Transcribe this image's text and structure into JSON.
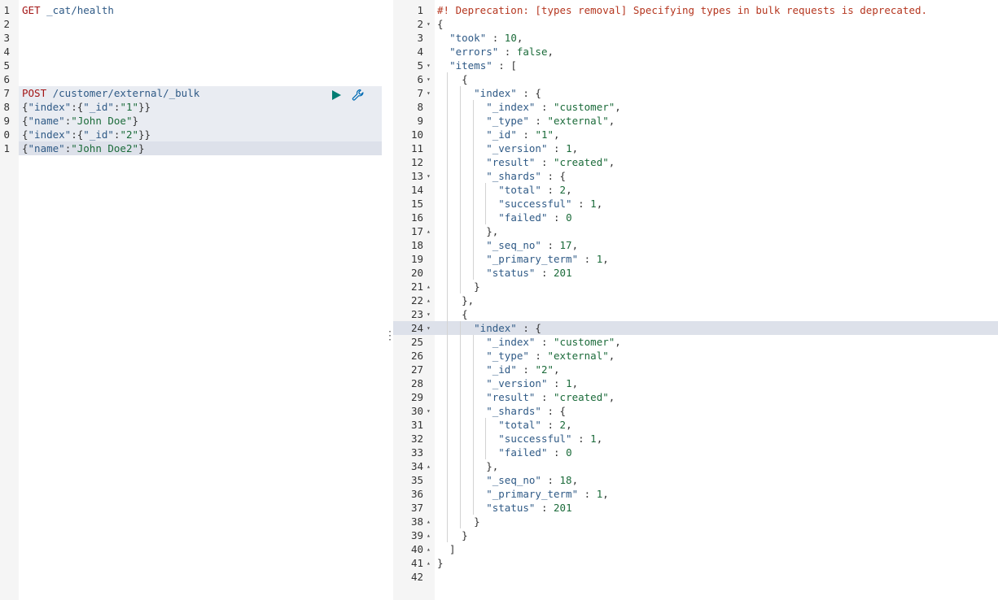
{
  "request_editor": {
    "lines": [
      {
        "num": "1",
        "segments": [
          {
            "t": "GET",
            "c": "method"
          },
          {
            "t": " _cat/health",
            "c": "path"
          }
        ]
      },
      {
        "num": "2",
        "segments": []
      },
      {
        "num": "3",
        "segments": []
      },
      {
        "num": "4",
        "segments": []
      },
      {
        "num": "5",
        "segments": []
      },
      {
        "num": "6",
        "segments": []
      },
      {
        "num": "7",
        "segments": [
          {
            "t": "POST",
            "c": "method"
          },
          {
            "t": " /customer/external/_bulk",
            "c": "path"
          }
        ]
      },
      {
        "num": "8",
        "segments": [
          {
            "t": "{",
            "c": "punc"
          },
          {
            "t": "\"index\"",
            "c": "key"
          },
          {
            "t": ":{",
            "c": "punc"
          },
          {
            "t": "\"_id\"",
            "c": "key"
          },
          {
            "t": ":",
            "c": "punc"
          },
          {
            "t": "\"1\"",
            "c": "str"
          },
          {
            "t": "}}",
            "c": "punc"
          }
        ]
      },
      {
        "num": "9",
        "segments": [
          {
            "t": "{",
            "c": "punc"
          },
          {
            "t": "\"name\"",
            "c": "key"
          },
          {
            "t": ":",
            "c": "punc"
          },
          {
            "t": "\"John Doe\"",
            "c": "str"
          },
          {
            "t": "}",
            "c": "punc"
          }
        ]
      },
      {
        "num": "0",
        "segments": [
          {
            "t": "{",
            "c": "punc"
          },
          {
            "t": "\"index\"",
            "c": "key"
          },
          {
            "t": ":{",
            "c": "punc"
          },
          {
            "t": "\"_id\"",
            "c": "key"
          },
          {
            "t": ":",
            "c": "punc"
          },
          {
            "t": "\"2\"",
            "c": "str"
          },
          {
            "t": "}}",
            "c": "punc"
          }
        ]
      },
      {
        "num": "1",
        "segments": [
          {
            "t": "{",
            "c": "punc"
          },
          {
            "t": "\"name\"",
            "c": "key"
          },
          {
            "t": ":",
            "c": "punc"
          },
          {
            "t": "\"John Doe2",
            "c": "str"
          },
          {
            "t": "\"",
            "c": "str"
          },
          {
            "t": "}",
            "c": "punc"
          }
        ]
      }
    ],
    "run_icon": "play-icon",
    "settings_icon": "wrench-icon"
  },
  "response_viewer": {
    "lines": [
      {
        "num": "1",
        "fold": "",
        "segments": [
          {
            "t": "#! Deprecation: [types removal] Specifying types in bulk requests is deprecated.",
            "c": "dep"
          }
        ]
      },
      {
        "num": "2",
        "fold": "▾",
        "segments": [
          {
            "t": "{",
            "c": "punc"
          }
        ]
      },
      {
        "num": "3",
        "fold": "",
        "segments": [
          {
            "t": "  ",
            "c": "punc"
          },
          {
            "t": "\"took\"",
            "c": "key"
          },
          {
            "t": " : ",
            "c": "punc"
          },
          {
            "t": "10",
            "c": "num"
          },
          {
            "t": ",",
            "c": "punc"
          }
        ]
      },
      {
        "num": "4",
        "fold": "",
        "segments": [
          {
            "t": "  ",
            "c": "punc"
          },
          {
            "t": "\"errors\"",
            "c": "key"
          },
          {
            "t": " : ",
            "c": "punc"
          },
          {
            "t": "false",
            "c": "bool"
          },
          {
            "t": ",",
            "c": "punc"
          }
        ]
      },
      {
        "num": "5",
        "fold": "▾",
        "segments": [
          {
            "t": "  ",
            "c": "punc"
          },
          {
            "t": "\"items\"",
            "c": "key"
          },
          {
            "t": " : [",
            "c": "punc"
          }
        ]
      },
      {
        "num": "6",
        "fold": "▾",
        "segments": [
          {
            "t": "    {",
            "c": "punc"
          }
        ]
      },
      {
        "num": "7",
        "fold": "▾",
        "segments": [
          {
            "t": "      ",
            "c": "punc"
          },
          {
            "t": "\"index\"",
            "c": "key"
          },
          {
            "t": " : {",
            "c": "punc"
          }
        ]
      },
      {
        "num": "8",
        "fold": "",
        "segments": [
          {
            "t": "        ",
            "c": "punc"
          },
          {
            "t": "\"_index\"",
            "c": "key"
          },
          {
            "t": " : ",
            "c": "punc"
          },
          {
            "t": "\"customer\"",
            "c": "str"
          },
          {
            "t": ",",
            "c": "punc"
          }
        ]
      },
      {
        "num": "9",
        "fold": "",
        "segments": [
          {
            "t": "        ",
            "c": "punc"
          },
          {
            "t": "\"_type\"",
            "c": "key"
          },
          {
            "t": " : ",
            "c": "punc"
          },
          {
            "t": "\"external\"",
            "c": "str"
          },
          {
            "t": ",",
            "c": "punc"
          }
        ]
      },
      {
        "num": "10",
        "fold": "",
        "segments": [
          {
            "t": "        ",
            "c": "punc"
          },
          {
            "t": "\"_id\"",
            "c": "key"
          },
          {
            "t": " : ",
            "c": "punc"
          },
          {
            "t": "\"1\"",
            "c": "str"
          },
          {
            "t": ",",
            "c": "punc"
          }
        ]
      },
      {
        "num": "11",
        "fold": "",
        "segments": [
          {
            "t": "        ",
            "c": "punc"
          },
          {
            "t": "\"_version\"",
            "c": "key"
          },
          {
            "t": " : ",
            "c": "punc"
          },
          {
            "t": "1",
            "c": "num"
          },
          {
            "t": ",",
            "c": "punc"
          }
        ]
      },
      {
        "num": "12",
        "fold": "",
        "segments": [
          {
            "t": "        ",
            "c": "punc"
          },
          {
            "t": "\"result\"",
            "c": "key"
          },
          {
            "t": " : ",
            "c": "punc"
          },
          {
            "t": "\"created\"",
            "c": "str"
          },
          {
            "t": ",",
            "c": "punc"
          }
        ]
      },
      {
        "num": "13",
        "fold": "▾",
        "segments": [
          {
            "t": "        ",
            "c": "punc"
          },
          {
            "t": "\"_shards\"",
            "c": "key"
          },
          {
            "t": " : {",
            "c": "punc"
          }
        ]
      },
      {
        "num": "14",
        "fold": "",
        "segments": [
          {
            "t": "          ",
            "c": "punc"
          },
          {
            "t": "\"total\"",
            "c": "key"
          },
          {
            "t": " : ",
            "c": "punc"
          },
          {
            "t": "2",
            "c": "num"
          },
          {
            "t": ",",
            "c": "punc"
          }
        ]
      },
      {
        "num": "15",
        "fold": "",
        "segments": [
          {
            "t": "          ",
            "c": "punc"
          },
          {
            "t": "\"successful\"",
            "c": "key"
          },
          {
            "t": " : ",
            "c": "punc"
          },
          {
            "t": "1",
            "c": "num"
          },
          {
            "t": ",",
            "c": "punc"
          }
        ]
      },
      {
        "num": "16",
        "fold": "",
        "segments": [
          {
            "t": "          ",
            "c": "punc"
          },
          {
            "t": "\"failed\"",
            "c": "key"
          },
          {
            "t": " : ",
            "c": "punc"
          },
          {
            "t": "0",
            "c": "num"
          }
        ]
      },
      {
        "num": "17",
        "fold": "▴",
        "segments": [
          {
            "t": "        },",
            "c": "punc"
          }
        ]
      },
      {
        "num": "18",
        "fold": "",
        "segments": [
          {
            "t": "        ",
            "c": "punc"
          },
          {
            "t": "\"_seq_no\"",
            "c": "key"
          },
          {
            "t": " : ",
            "c": "punc"
          },
          {
            "t": "17",
            "c": "num"
          },
          {
            "t": ",",
            "c": "punc"
          }
        ]
      },
      {
        "num": "19",
        "fold": "",
        "segments": [
          {
            "t": "        ",
            "c": "punc"
          },
          {
            "t": "\"_primary_term\"",
            "c": "key"
          },
          {
            "t": " : ",
            "c": "punc"
          },
          {
            "t": "1",
            "c": "num"
          },
          {
            "t": ",",
            "c": "punc"
          }
        ]
      },
      {
        "num": "20",
        "fold": "",
        "segments": [
          {
            "t": "        ",
            "c": "punc"
          },
          {
            "t": "\"status\"",
            "c": "key"
          },
          {
            "t": " : ",
            "c": "punc"
          },
          {
            "t": "201",
            "c": "num"
          }
        ]
      },
      {
        "num": "21",
        "fold": "▴",
        "segments": [
          {
            "t": "      }",
            "c": "punc"
          }
        ]
      },
      {
        "num": "22",
        "fold": "▴",
        "segments": [
          {
            "t": "    },",
            "c": "punc"
          }
        ]
      },
      {
        "num": "23",
        "fold": "▾",
        "segments": [
          {
            "t": "    {",
            "c": "punc"
          }
        ]
      },
      {
        "num": "24",
        "fold": "▾",
        "segments": [
          {
            "t": "      ",
            "c": "punc"
          },
          {
            "t": "\"index\"",
            "c": "key"
          },
          {
            "t": " : {",
            "c": "punc"
          }
        ]
      },
      {
        "num": "25",
        "fold": "",
        "segments": [
          {
            "t": "        ",
            "c": "punc"
          },
          {
            "t": "\"_index\"",
            "c": "key"
          },
          {
            "t": " : ",
            "c": "punc"
          },
          {
            "t": "\"customer\"",
            "c": "str"
          },
          {
            "t": ",",
            "c": "punc"
          }
        ]
      },
      {
        "num": "26",
        "fold": "",
        "segments": [
          {
            "t": "        ",
            "c": "punc"
          },
          {
            "t": "\"_type\"",
            "c": "key"
          },
          {
            "t": " : ",
            "c": "punc"
          },
          {
            "t": "\"external\"",
            "c": "str"
          },
          {
            "t": ",",
            "c": "punc"
          }
        ]
      },
      {
        "num": "27",
        "fold": "",
        "segments": [
          {
            "t": "        ",
            "c": "punc"
          },
          {
            "t": "\"_id\"",
            "c": "key"
          },
          {
            "t": " : ",
            "c": "punc"
          },
          {
            "t": "\"2\"",
            "c": "str"
          },
          {
            "t": ",",
            "c": "punc"
          }
        ]
      },
      {
        "num": "28",
        "fold": "",
        "segments": [
          {
            "t": "        ",
            "c": "punc"
          },
          {
            "t": "\"_version\"",
            "c": "key"
          },
          {
            "t": " : ",
            "c": "punc"
          },
          {
            "t": "1",
            "c": "num"
          },
          {
            "t": ",",
            "c": "punc"
          }
        ]
      },
      {
        "num": "29",
        "fold": "",
        "segments": [
          {
            "t": "        ",
            "c": "punc"
          },
          {
            "t": "\"result\"",
            "c": "key"
          },
          {
            "t": " : ",
            "c": "punc"
          },
          {
            "t": "\"created\"",
            "c": "str"
          },
          {
            "t": ",",
            "c": "punc"
          }
        ]
      },
      {
        "num": "30",
        "fold": "▾",
        "segments": [
          {
            "t": "        ",
            "c": "punc"
          },
          {
            "t": "\"_shards\"",
            "c": "key"
          },
          {
            "t": " : {",
            "c": "punc"
          }
        ]
      },
      {
        "num": "31",
        "fold": "",
        "segments": [
          {
            "t": "          ",
            "c": "punc"
          },
          {
            "t": "\"total\"",
            "c": "key"
          },
          {
            "t": " : ",
            "c": "punc"
          },
          {
            "t": "2",
            "c": "num"
          },
          {
            "t": ",",
            "c": "punc"
          }
        ]
      },
      {
        "num": "32",
        "fold": "",
        "segments": [
          {
            "t": "          ",
            "c": "punc"
          },
          {
            "t": "\"successful\"",
            "c": "key"
          },
          {
            "t": " : ",
            "c": "punc"
          },
          {
            "t": "1",
            "c": "num"
          },
          {
            "t": ",",
            "c": "punc"
          }
        ]
      },
      {
        "num": "33",
        "fold": "",
        "segments": [
          {
            "t": "          ",
            "c": "punc"
          },
          {
            "t": "\"failed\"",
            "c": "key"
          },
          {
            "t": " : ",
            "c": "punc"
          },
          {
            "t": "0",
            "c": "num"
          }
        ]
      },
      {
        "num": "34",
        "fold": "▴",
        "segments": [
          {
            "t": "        },",
            "c": "punc"
          }
        ]
      },
      {
        "num": "35",
        "fold": "",
        "segments": [
          {
            "t": "        ",
            "c": "punc"
          },
          {
            "t": "\"_seq_no\"",
            "c": "key"
          },
          {
            "t": " : ",
            "c": "punc"
          },
          {
            "t": "18",
            "c": "num"
          },
          {
            "t": ",",
            "c": "punc"
          }
        ]
      },
      {
        "num": "36",
        "fold": "",
        "segments": [
          {
            "t": "        ",
            "c": "punc"
          },
          {
            "t": "\"_primary_term\"",
            "c": "key"
          },
          {
            "t": " : ",
            "c": "punc"
          },
          {
            "t": "1",
            "c": "num"
          },
          {
            "t": ",",
            "c": "punc"
          }
        ]
      },
      {
        "num": "37",
        "fold": "",
        "segments": [
          {
            "t": "        ",
            "c": "punc"
          },
          {
            "t": "\"status\"",
            "c": "key"
          },
          {
            "t": " : ",
            "c": "punc"
          },
          {
            "t": "201",
            "c": "num"
          }
        ]
      },
      {
        "num": "38",
        "fold": "▴",
        "segments": [
          {
            "t": "      }",
            "c": "punc"
          }
        ]
      },
      {
        "num": "39",
        "fold": "▴",
        "segments": [
          {
            "t": "    }",
            "c": "punc"
          }
        ]
      },
      {
        "num": "40",
        "fold": "▴",
        "segments": [
          {
            "t": "  ]",
            "c": "punc"
          }
        ]
      },
      {
        "num": "41",
        "fold": "▴",
        "segments": [
          {
            "t": "}",
            "c": "punc"
          }
        ]
      },
      {
        "num": "42",
        "fold": "",
        "segments": []
      }
    ]
  },
  "resizer": {
    "icon": "vertical-dots-icon",
    "glyph": "⋮"
  }
}
